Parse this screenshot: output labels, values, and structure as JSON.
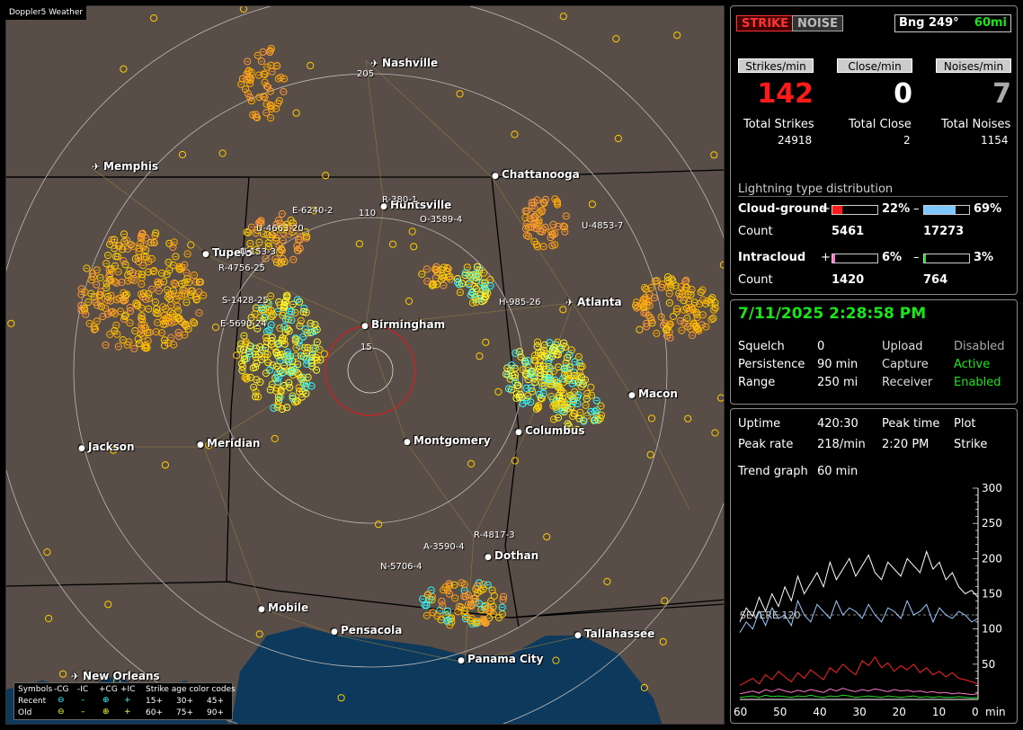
{
  "app": {
    "title": "Doppler5 Weather"
  },
  "map": {
    "cities": [
      {
        "name": "Nashville",
        "airport": true
      },
      {
        "name": "Memphis",
        "airport": true
      },
      {
        "name": "Chattanooga",
        "airport": false
      },
      {
        "name": "Huntsville",
        "airport": false
      },
      {
        "name": "Tupelo",
        "airport": false
      },
      {
        "name": "Birmingham",
        "airport": false
      },
      {
        "name": "Atlanta",
        "airport": true
      },
      {
        "name": "Macon",
        "airport": false
      },
      {
        "name": "Columbus",
        "airport": false
      },
      {
        "name": "Montgomery",
        "airport": false
      },
      {
        "name": "Meridian",
        "airport": false
      },
      {
        "name": "Jackson",
        "airport": false
      },
      {
        "name": "Dothan",
        "airport": false
      },
      {
        "name": "Mobile",
        "airport": false
      },
      {
        "name": "Pensacola",
        "airport": false
      },
      {
        "name": "Tallahassee",
        "airport": false
      },
      {
        "name": "Panama City",
        "airport": false
      },
      {
        "name": "New Orleans",
        "airport": true
      }
    ],
    "ring_labels": [
      "205",
      "110",
      "15"
    ],
    "cell_labels": [
      "E-6240-2",
      "O-3589-4",
      "U-4853-7",
      "U-4663-20",
      "R-4756-25",
      "S-1428-25",
      "E-5690-24",
      "H-985-26",
      "R-4817-3",
      "A-3590-4",
      "N-5706-4",
      "R-380-1",
      "U-153-3"
    ],
    "legend": {
      "header": [
        "Symbols",
        "-CG",
        "-IC",
        "+CG",
        "+IC",
        "Strike age color codes"
      ],
      "recent_label": "Recent",
      "old_label": "Old",
      "recent_codes": [
        "15+",
        "30+",
        "45+"
      ],
      "old_codes": [
        "60+",
        "75+",
        "90+"
      ],
      "recent_colors": [
        "#ffff33",
        "#ffcc00",
        "#ff9933"
      ],
      "old_colors": [
        "#ff9933",
        "#ff6633",
        "#ff3333"
      ]
    }
  },
  "status": {
    "strike_btn": "STRIKE",
    "noise_btn": "NOISE",
    "bearing": "Bng 249°",
    "range_sel": "60mi",
    "headers": [
      "Strikes/min",
      "Close/min",
      "Noises/min"
    ],
    "strikes_min": "142",
    "close_min": "0",
    "noises_min": "7",
    "total_labels": [
      "Total Strikes",
      "Total Close",
      "Total Noises"
    ],
    "total_values": [
      "24918",
      "2",
      "1154"
    ],
    "dist_title": "Lightning type distribution",
    "cg_label": "Cloud-ground",
    "ic_label": "Intracloud",
    "count_label": "Count",
    "plus": "+",
    "minus": "–",
    "cg_pos_pct": "22%",
    "cg_neg_pct": "69%",
    "cg_pos_count": "5461",
    "cg_neg_count": "17273",
    "ic_pos_pct": "6%",
    "ic_neg_pct": "3%",
    "ic_pos_count": "1420",
    "ic_neg_count": "764",
    "bar_fill": {
      "cg_pos": 0.22,
      "cg_neg": 0.69,
      "ic_pos": 0.06,
      "ic_neg": 0.03
    }
  },
  "settings": {
    "datetime": "7/11/2025 2:28:58 PM",
    "rows": [
      [
        "Squelch",
        "0",
        "Upload",
        "Disabled"
      ],
      [
        "Persistence",
        "90 min",
        "Capture",
        "Active"
      ],
      [
        "Range",
        "250 mi",
        "Receiver",
        "Enabled"
      ]
    ]
  },
  "stats": {
    "uptime_label": "Uptime",
    "uptime": "420:30",
    "peak_time_label": "Peak time",
    "peak_time": "2:20 PM",
    "plot_label": "Plot",
    "peak_rate_label": "Peak rate",
    "peak_rate": "218/min",
    "plot_value": "Strike",
    "trend_label": "Trend graph",
    "trend_value": "60 min",
    "severe_label": "SEVERE 120"
  },
  "colors": {
    "accent_green": "#19e619",
    "strike_red": "#ff1a1a",
    "panel_border": "#888888"
  },
  "chart_data": {
    "type": "line",
    "xlabel": "min",
    "x_ticks": [
      "60",
      "50",
      "40",
      "30",
      "20",
      "10",
      "0"
    ],
    "y_ticks": [
      "300",
      "250",
      "200",
      "150",
      "100",
      "50"
    ],
    "ylim": [
      0,
      300
    ],
    "xlim": [
      60,
      0
    ],
    "severe_level": 120,
    "series": [
      {
        "color": "#ffffff",
        "values": [
          110,
          130,
          118,
          145,
          125,
          150,
          132,
          160,
          140,
          175,
          150,
          165,
          180,
          160,
          195,
          170,
          185,
          200,
          175,
          190,
          205,
          180,
          170,
          195,
          185,
          175,
          200,
          190,
          180,
          210,
          185,
          195,
          170,
          180,
          160,
          150,
          155,
          145
        ]
      },
      {
        "color": "#99ccff",
        "values": [
          95,
          110,
          100,
          125,
          105,
          130,
          115,
          120,
          105,
          140,
          120,
          110,
          135,
          125,
          115,
          140,
          120,
          130,
          125,
          115,
          135,
          120,
          110,
          130,
          125,
          115,
          140,
          120,
          125,
          135,
          110,
          130,
          120,
          115,
          125,
          120,
          110,
          115
        ]
      },
      {
        "color": "#ff2222",
        "values": [
          20,
          25,
          30,
          22,
          35,
          28,
          40,
          32,
          25,
          38,
          30,
          42,
          35,
          28,
          45,
          38,
          50,
          42,
          35,
          55,
          48,
          60,
          45,
          52,
          40,
          48,
          42,
          50,
          38,
          45,
          35,
          40,
          32,
          38,
          30,
          28,
          25,
          22
        ]
      },
      {
        "color": "#ff77cc",
        "values": [
          8,
          10,
          12,
          9,
          14,
          11,
          15,
          12,
          10,
          13,
          11,
          14,
          12,
          10,
          15,
          12,
          16,
          13,
          11,
          14,
          12,
          15,
          13,
          11,
          14,
          12,
          13,
          11,
          12,
          10,
          11,
          9,
          10,
          8,
          9,
          8,
          7,
          8
        ]
      },
      {
        "color": "#22dd22",
        "values": [
          3,
          4,
          5,
          3,
          6,
          4,
          5,
          4,
          3,
          5,
          4,
          6,
          4,
          3,
          5,
          4,
          6,
          5,
          3,
          4,
          5,
          4,
          3,
          5,
          4,
          3,
          4,
          5,
          3,
          4,
          3,
          4,
          3,
          3,
          4,
          3,
          2,
          3
        ]
      }
    ]
  }
}
